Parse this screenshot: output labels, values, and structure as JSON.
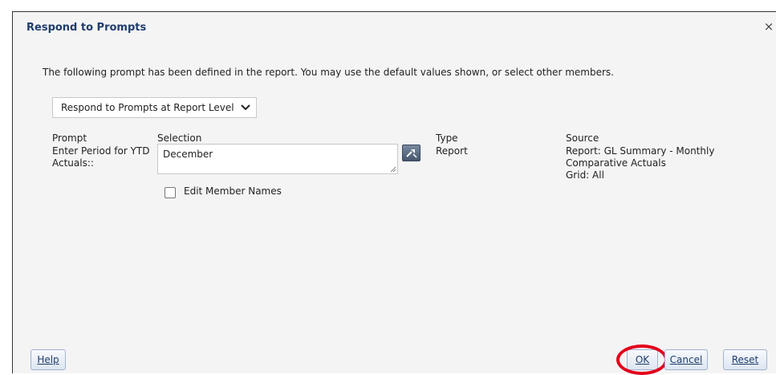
{
  "dialog": {
    "title": "Respond to Prompts",
    "close_glyph": "×",
    "instruction": "The following prompt has been defined in the report. You may use the default values shown, or select other members."
  },
  "level_select": {
    "value": "Respond to Prompts at Report Level",
    "icon": "chevron-down-icon"
  },
  "columns": {
    "prompt": "Prompt",
    "selection": "Selection",
    "type": "Type",
    "source": "Source"
  },
  "prompt_row": {
    "prompt_line1": "Enter Period for YTD",
    "prompt_line2": "Actuals::",
    "selection_value": "December",
    "member_selector_icon": "member-selector-icon",
    "type": "Report",
    "source_line1": "Report: GL Summary - Monthly",
    "source_line2": "Comparative Actuals",
    "source_line3": "Grid: All"
  },
  "edit_member_names": {
    "label": "Edit Member Names",
    "checked": false
  },
  "footer": {
    "help_label": "Help",
    "ok_label": "OK",
    "cancel_label": "Cancel",
    "reset_label": "Reset"
  },
  "colors": {
    "title": "#1f3d6e",
    "highlight": "#e3001b"
  }
}
